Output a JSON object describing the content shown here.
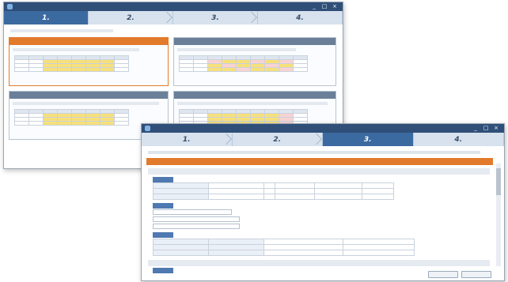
{
  "colors": {
    "titlebar": "#2f4f78",
    "active_step": "#3b6aa0",
    "accent_orange": "#e27a2c",
    "panel_header": "#6b7f98"
  },
  "window_back": {
    "title": "",
    "steps": [
      {
        "num": "1.",
        "label": ""
      },
      {
        "num": "2.",
        "label": ""
      },
      {
        "num": "3.",
        "label": ""
      },
      {
        "num": "4.",
        "label": ""
      }
    ],
    "controls": [
      "_",
      "□",
      "×"
    ]
  },
  "window_front": {
    "title": "",
    "steps": [
      {
        "num": "1.",
        "label": ""
      },
      {
        "num": "2.",
        "label": ""
      },
      {
        "num": "3.",
        "label": ""
      },
      {
        "num": "4.",
        "label": ""
      }
    ],
    "controls": [
      "_",
      "□",
      "×"
    ]
  }
}
